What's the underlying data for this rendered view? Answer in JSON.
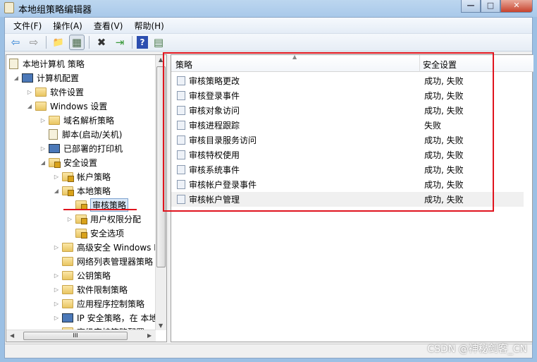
{
  "window": {
    "title": "本地组策略编辑器",
    "minimize": "—",
    "maximize": "□",
    "close": "✕"
  },
  "menu": [
    "文件(F)",
    "操作(A)",
    "查看(V)",
    "帮助(H)"
  ],
  "toolbar": {
    "back": "⇦",
    "forward": "⇨",
    "up": "📁",
    "show_hide": "▦",
    "delete": "✖",
    "export": "⇥",
    "help": "?",
    "properties": "▤"
  },
  "tree": [
    {
      "label": "本地计算机 策略",
      "level": 0,
      "icon": "doc",
      "twisty": ""
    },
    {
      "label": "计算机配置",
      "level": 1,
      "icon": "pc",
      "twisty": "◢"
    },
    {
      "label": "软件设置",
      "level": 2,
      "icon": "folder",
      "twisty": "▷"
    },
    {
      "label": "Windows 设置",
      "level": 2,
      "icon": "folder",
      "twisty": "◢"
    },
    {
      "label": "域名解析策略",
      "level": 3,
      "icon": "folder",
      "twisty": "▷"
    },
    {
      "label": "脚本(启动/关机)",
      "level": 3,
      "icon": "doc",
      "twisty": ""
    },
    {
      "label": "已部署的打印机",
      "level": 3,
      "icon": "pc",
      "twisty": "▷"
    },
    {
      "label": "安全设置",
      "level": 3,
      "icon": "folder-lock",
      "twisty": "◢"
    },
    {
      "label": "帐户策略",
      "level": 4,
      "icon": "folder-lock",
      "twisty": "▷"
    },
    {
      "label": "本地策略",
      "level": 4,
      "icon": "folder-lock",
      "twisty": "◢"
    },
    {
      "label": "审核策略",
      "level": 5,
      "icon": "folder-lock",
      "twisty": "",
      "selected": true
    },
    {
      "label": "用户权限分配",
      "level": 5,
      "icon": "folder-lock",
      "twisty": "▷"
    },
    {
      "label": "安全选项",
      "level": 5,
      "icon": "folder-lock",
      "twisty": ""
    },
    {
      "label": "高级安全 Windows F",
      "level": 4,
      "icon": "folder",
      "twisty": "▷"
    },
    {
      "label": "网络列表管理器策略",
      "level": 4,
      "icon": "folder",
      "twisty": ""
    },
    {
      "label": "公钥策略",
      "level": 4,
      "icon": "folder",
      "twisty": "▷"
    },
    {
      "label": "软件限制策略",
      "level": 4,
      "icon": "folder",
      "twisty": "▷"
    },
    {
      "label": "应用程序控制策略",
      "level": 4,
      "icon": "folder",
      "twisty": "▷"
    },
    {
      "label": "IP 安全策略，在 本地",
      "level": 4,
      "icon": "pc",
      "twisty": "▷"
    },
    {
      "label": "高级审核策略配置",
      "level": 4,
      "icon": "folder",
      "twisty": "▷"
    }
  ],
  "list": {
    "columns": [
      "策略",
      "安全设置"
    ],
    "rows": [
      {
        "policy": "审核策略更改",
        "setting": "成功, 失败"
      },
      {
        "policy": "审核登录事件",
        "setting": "成功, 失败"
      },
      {
        "policy": "审核对象访问",
        "setting": "成功, 失败"
      },
      {
        "policy": "审核进程跟踪",
        "setting": "失败"
      },
      {
        "policy": "审核目录服务访问",
        "setting": "成功, 失败"
      },
      {
        "policy": "审核特权使用",
        "setting": "成功, 失败"
      },
      {
        "policy": "审核系统事件",
        "setting": "成功, 失败"
      },
      {
        "policy": "审核帐户登录事件",
        "setting": "成功, 失败"
      },
      {
        "policy": "审核帐户管理",
        "setting": "成功, 失败"
      }
    ]
  },
  "scrollbar_grip": "III",
  "watermark": "CSDN @神秘剑客_CN",
  "colors": {
    "highlight": "#e0141e",
    "selection": "#dbe9f8"
  }
}
